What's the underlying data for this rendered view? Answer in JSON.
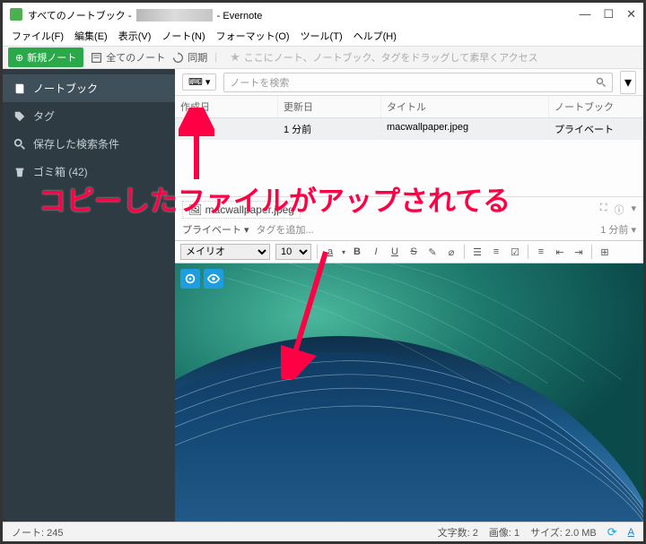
{
  "title": {
    "prefix": "すべてのノートブック - ",
    "suffix": " - Evernote"
  },
  "window_controls": {
    "min": "—",
    "max": "☐",
    "close": "✕"
  },
  "menu": [
    "ファイル(F)",
    "編集(E)",
    "表示(V)",
    "ノート(N)",
    "フォーマット(O)",
    "ツール(T)",
    "ヘルプ(H)"
  ],
  "toolbar": {
    "new_note": "新規ノート",
    "all_notes": "全てのノート",
    "sync": "同期",
    "global_search_placeholder": "ここにノート、ノートブック、タグをドラッグして素早くアクセス"
  },
  "sidebar": {
    "items": [
      {
        "label": "ノートブック",
        "icon": "book",
        "active": true
      },
      {
        "label": "タグ",
        "icon": "tag",
        "active": false
      },
      {
        "label": "保存した検索条件",
        "icon": "search",
        "active": false
      },
      {
        "label": "ゴミ箱  (42)",
        "icon": "trash",
        "active": false
      }
    ]
  },
  "notelist": {
    "search_placeholder": "ノートを検索",
    "columns": {
      "created": "作成日",
      "updated": "更新日",
      "title": "タイトル",
      "notebook": "ノートブック"
    },
    "rows": [
      {
        "created": "1 分前",
        "updated": "1 分前",
        "title": "macwallpaper.jpeg",
        "notebook": "プライベート"
      }
    ]
  },
  "editor": {
    "attached_file": "macwallpaper.jpeg",
    "notebook": "プライベート",
    "add_tag": "タグを追加...",
    "time": "1 分前",
    "font": "メイリオ",
    "size": "10"
  },
  "statusbar": {
    "left": "ノート: 245",
    "words": "文字数: 2",
    "images": "画像: 1",
    "size": "サイズ: 2.0 MB"
  },
  "annotation": "コピーしたファイルがアップされてる"
}
